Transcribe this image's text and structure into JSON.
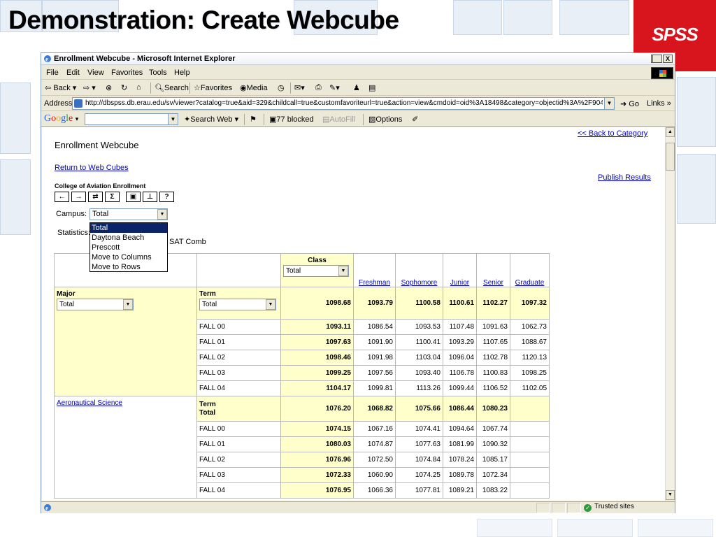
{
  "slide": {
    "title": "Demonstration: Create Webcube",
    "logo": "SPSS"
  },
  "window": {
    "title": "Enrollment Webcube - Microsoft Internet Explorer",
    "buttons": {
      "minimize": "_",
      "maximize": "□",
      "close": "X"
    }
  },
  "menu": [
    "File",
    "Edit",
    "View",
    "Favorites",
    "Tools",
    "Help"
  ],
  "toolbar": {
    "back": "Back",
    "search": "Search",
    "favorites": "Favorites",
    "media": "Media"
  },
  "address": {
    "label": "Address",
    "url": "http://dbspss.db.erau.edu/sv/viewer?catalog=true&aid=329&childcall=true&customfavoriteurl=true&action=view&cmdoid=oid%3A18498&category=objectid%3A%2F90478",
    "go": "Go",
    "links": "Links"
  },
  "google": {
    "logo": "Google",
    "search_web": "Search Web",
    "blocked": "77 blocked",
    "autofill": "AutoFill",
    "options": "Options"
  },
  "page": {
    "back_to_category": "<< Back to Category",
    "heading": "Enrollment Webcube",
    "return_link": "Return to Web Cubes",
    "publish": "Publish Results",
    "subheading": "College of Aviation Enrollment",
    "icons": [
      "←",
      "→",
      "⇄",
      "Σ",
      "▣",
      "⊥",
      "?"
    ],
    "campus_label": "Campus:",
    "campus_value": "Total",
    "campus_options": [
      "Total",
      "Daytona Beach",
      "Prescott",
      "Move to Columns",
      "Move to Rows"
    ],
    "statistics_label": "Statistics:",
    "statistics_value": "SAT Comb"
  },
  "table": {
    "class_label": "Class",
    "class_value": "Total",
    "columns": [
      "Freshman",
      "Sophomore",
      "Junior",
      "Senior",
      "Graduate"
    ],
    "major_label": "Major",
    "major_value": "Total",
    "term_label": "Term",
    "term_value": "Total",
    "total_row": [
      "1098.68",
      "1093.79",
      "1100.58",
      "1100.61",
      "1102.27",
      "1097.32"
    ],
    "total_terms": [
      {
        "term": "FALL 00",
        "values": [
          "1093.11",
          "1086.54",
          "1093.53",
          "1107.48",
          "1091.63",
          "1062.73"
        ]
      },
      {
        "term": "FALL 01",
        "values": [
          "1097.63",
          "1091.90",
          "1100.41",
          "1093.29",
          "1107.65",
          "1088.67"
        ]
      },
      {
        "term": "FALL 02",
        "values": [
          "1098.46",
          "1091.98",
          "1103.04",
          "1096.04",
          "1102.78",
          "1120.13"
        ]
      },
      {
        "term": "FALL 03",
        "values": [
          "1099.25",
          "1097.56",
          "1093.40",
          "1106.78",
          "1100.83",
          "1098.25"
        ]
      },
      {
        "term": "FALL 04",
        "values": [
          "1104.17",
          "1099.81",
          "1113.26",
          "1099.44",
          "1106.52",
          "1102.05"
        ]
      }
    ],
    "aero_major": "Aeronautical Science",
    "aero_term_total": [
      "Term",
      "Total"
    ],
    "aero_total_row": [
      "1076.20",
      "1068.82",
      "1075.66",
      "1086.44",
      "1080.23",
      ""
    ],
    "aero_terms": [
      {
        "term": "FALL 00",
        "values": [
          "1074.15",
          "1067.16",
          "1074.41",
          "1094.64",
          "1067.74",
          ""
        ]
      },
      {
        "term": "FALL 01",
        "values": [
          "1080.03",
          "1074.87",
          "1077.63",
          "1081.99",
          "1090.32",
          ""
        ]
      },
      {
        "term": "FALL 02",
        "values": [
          "1076.96",
          "1072.50",
          "1074.84",
          "1078.24",
          "1085.17",
          ""
        ]
      },
      {
        "term": "FALL 03",
        "values": [
          "1072.33",
          "1060.90",
          "1074.25",
          "1089.78",
          "1072.34",
          ""
        ]
      },
      {
        "term": "FALL 04",
        "values": [
          "1076.95",
          "1066.36",
          "1077.81",
          "1089.21",
          "1083.22",
          ""
        ]
      }
    ]
  },
  "status": {
    "trusted": "Trusted sites"
  },
  "colors": {
    "accent_red": "#d8141c",
    "highlight_yellow": "#ffffcc",
    "link_blue": "#0000cc"
  }
}
